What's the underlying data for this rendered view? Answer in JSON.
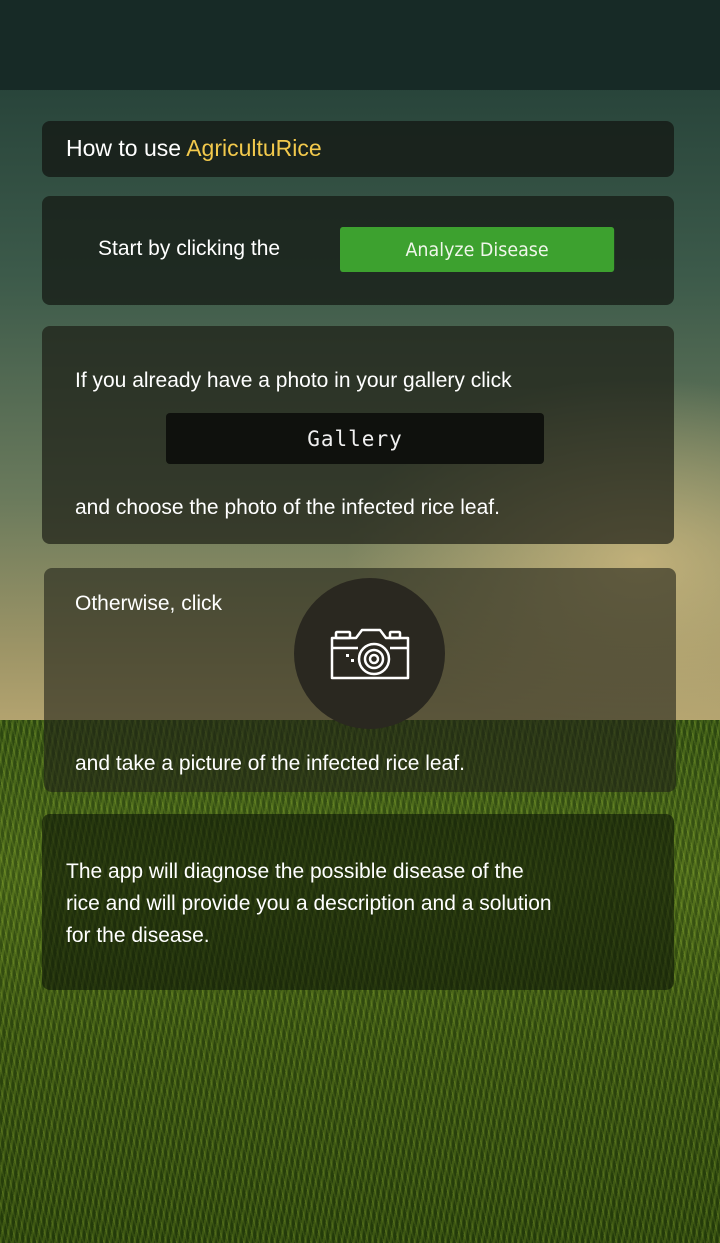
{
  "title": {
    "prefix": "How to use ",
    "app_name": "AgricultuRice"
  },
  "step1": {
    "text": "Start by clicking the",
    "button_label": "Analyze Disease"
  },
  "step2": {
    "text_before": "If you already have a photo in your gallery click",
    "button_label": "Gallery",
    "text_after": "and choose the photo of the infected rice leaf."
  },
  "step3": {
    "text_before": "Otherwise, click",
    "button_icon": "camera-icon",
    "text_after": "and take a picture of the infected rice leaf."
  },
  "step4": {
    "lines": [
      "The app will diagnose the possible disease of the",
      "rice and will provide you a description and a solution",
      "for the disease."
    ]
  },
  "colors": {
    "accent": "#f2c94c",
    "analyze_button": "#3da12f",
    "gallery_button": "#0f110d",
    "status_bar": "#172a26"
  }
}
